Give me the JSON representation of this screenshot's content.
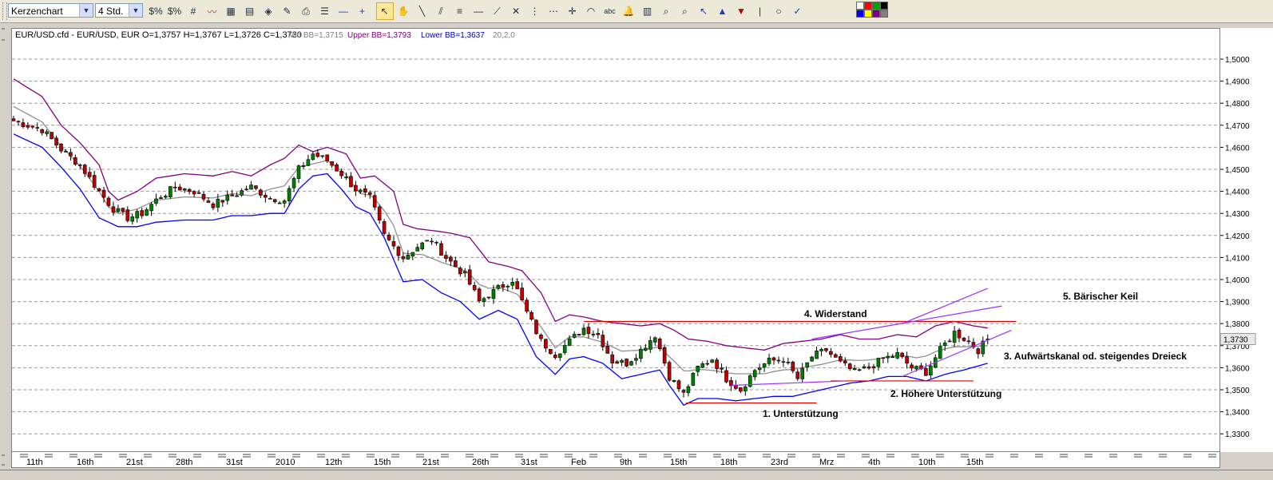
{
  "toolbar": {
    "chart_type_value": "Kerzenchart",
    "timeframe_value": "4 Std.",
    "icons": [
      "dollar-percent-icon",
      "dollar-scale-icon",
      "grid-icon",
      "line-chart-icon",
      "chart-window-icon",
      "templates-icon",
      "layers-icon",
      "drawings-icon",
      "print-icon",
      "properties-icon",
      "zoom-out-icon",
      "zoom-in-icon",
      "cursor-icon",
      "hand-icon",
      "line-tool-icon",
      "parallel-tool-icon",
      "fibonacci-icon",
      "horizontal-line-icon",
      "gann-fan-icon",
      "cross-tool-icon",
      "vertical-lines-icon",
      "dotted-lines-icon",
      "crosshair-icon",
      "arc-icon",
      "text-tool-icon",
      "bell-icon",
      "calculator-icon",
      "magnifier-icon",
      "magnifier-reset-icon",
      "arrow-up-left-icon",
      "arrow-up-icon",
      "arrow-down-icon",
      "separator-icon",
      "circle-icon",
      "checkmark-icon",
      "color-palette-icon"
    ],
    "palette": [
      "#ffffff",
      "#ff0000",
      "#00a000",
      "#000000",
      "#0000ff",
      "#ffff00",
      "#800080",
      "#808080"
    ]
  },
  "legend": {
    "symbol_text": "EUR/USD.cfd - EUR/USD, EUR O=1,3757 H=1,3767 L=1,3726 C=1,3730",
    "mid_bb": "Mid BB=1,3715",
    "upper_bb": "Upper BB=1,3793",
    "lower_bb": "Lower BB=1,3637",
    "params": "20,2,0"
  },
  "colors": {
    "upper_band": "#800080",
    "lower_band": "#0000ff",
    "mid_band": "#909090",
    "candle_up": "#008000",
    "candle_down": "#c00000",
    "annotation_red": "#e00000",
    "annotation_purple": "#9b30ff"
  },
  "chart_data": {
    "type": "candlestick",
    "symbol": "EUR/USD",
    "timeframe": "4 Std.",
    "ylim": [
      1.325,
      1.51
    ],
    "y_ticks": [
      "1,3300",
      "1,3400",
      "1,3500",
      "1,3600",
      "1,3700",
      "1,3800",
      "1,3900",
      "1,4000",
      "1,4100",
      "1,4200",
      "1,4300",
      "1,4400",
      "1,4500",
      "1,4600",
      "1,4700",
      "1,4800",
      "1,4900",
      "1,5000"
    ],
    "x_ticks": [
      "11th",
      "16th",
      "21st",
      "28th",
      "31st",
      "2010",
      "12th",
      "15th",
      "21st",
      "26th",
      "31st",
      "Feb",
      "9th",
      "15th",
      "18th",
      "23rd",
      "Mrz",
      "4th",
      "10th",
      "15th"
    ],
    "last_price": 1.373,
    "last_price_label": "1,3730",
    "grid": true,
    "close_path": [
      [
        0,
        1.472
      ],
      [
        6,
        1.468
      ],
      [
        10,
        1.459
      ],
      [
        14,
        1.452
      ],
      [
        18,
        1.44
      ],
      [
        21,
        1.432
      ],
      [
        24,
        1.428
      ],
      [
        27,
        1.43
      ],
      [
        30,
        1.436
      ],
      [
        34,
        1.442
      ],
      [
        38,
        1.44
      ],
      [
        42,
        1.434
      ],
      [
        46,
        1.438
      ],
      [
        50,
        1.442
      ],
      [
        54,
        1.437
      ],
      [
        57,
        1.436
      ],
      [
        60,
        1.45
      ],
      [
        63,
        1.457
      ],
      [
        66,
        1.454
      ],
      [
        69,
        1.448
      ],
      [
        72,
        1.441
      ],
      [
        75,
        1.437
      ],
      [
        78,
        1.42
      ],
      [
        82,
        1.41
      ],
      [
        85,
        1.415
      ],
      [
        88,
        1.418
      ],
      [
        91,
        1.41
      ],
      [
        95,
        1.402
      ],
      [
        98,
        1.39
      ],
      [
        102,
        1.396
      ],
      [
        105,
        1.4
      ],
      [
        108,
        1.385
      ],
      [
        111,
        1.372
      ],
      [
        114,
        1.366
      ],
      [
        117,
        1.372
      ],
      [
        120,
        1.378
      ],
      [
        123,
        1.375
      ],
      [
        126,
        1.363
      ],
      [
        129,
        1.362
      ],
      [
        132,
        1.368
      ],
      [
        135,
        1.375
      ],
      [
        138,
        1.356
      ],
      [
        141,
        1.348
      ],
      [
        144,
        1.36
      ],
      [
        147,
        1.364
      ],
      [
        150,
        1.355
      ],
      [
        153,
        1.35
      ],
      [
        156,
        1.359
      ],
      [
        159,
        1.363
      ],
      [
        162,
        1.364
      ],
      [
        165,
        1.355
      ],
      [
        168,
        1.365
      ],
      [
        171,
        1.368
      ],
      [
        174,
        1.362
      ],
      [
        177,
        1.358
      ],
      [
        180,
        1.36
      ],
      [
        183,
        1.364
      ],
      [
        186,
        1.366
      ],
      [
        189,
        1.36
      ],
      [
        192,
        1.358
      ],
      [
        195,
        1.368
      ],
      [
        198,
        1.376
      ],
      [
        201,
        1.372
      ],
      [
        203,
        1.368
      ],
      [
        205,
        1.373
      ]
    ],
    "upper_band": [
      [
        0,
        1.491
      ],
      [
        6,
        1.483
      ],
      [
        10,
        1.47
      ],
      [
        14,
        1.462
      ],
      [
        18,
        1.452
      ],
      [
        20,
        1.44
      ],
      [
        22,
        1.436
      ],
      [
        26,
        1.44
      ],
      [
        30,
        1.446
      ],
      [
        36,
        1.448
      ],
      [
        42,
        1.447
      ],
      [
        46,
        1.449
      ],
      [
        50,
        1.447
      ],
      [
        54,
        1.452
      ],
      [
        57,
        1.455
      ],
      [
        60,
        1.461
      ],
      [
        63,
        1.458
      ],
      [
        66,
        1.46
      ],
      [
        70,
        1.457
      ],
      [
        73,
        1.446
      ],
      [
        76,
        1.447
      ],
      [
        80,
        1.44
      ],
      [
        82,
        1.425
      ],
      [
        85,
        1.423
      ],
      [
        89,
        1.422
      ],
      [
        92,
        1.421
      ],
      [
        96,
        1.419
      ],
      [
        100,
        1.408
      ],
      [
        104,
        1.406
      ],
      [
        107,
        1.404
      ],
      [
        111,
        1.394
      ],
      [
        114,
        1.381
      ],
      [
        117,
        1.384
      ],
      [
        120,
        1.383
      ],
      [
        124,
        1.381
      ],
      [
        128,
        1.38
      ],
      [
        132,
        1.379
      ],
      [
        136,
        1.38
      ],
      [
        139,
        1.377
      ],
      [
        142,
        1.373
      ],
      [
        146,
        1.372
      ],
      [
        150,
        1.37
      ],
      [
        154,
        1.369
      ],
      [
        158,
        1.368
      ],
      [
        162,
        1.371
      ],
      [
        166,
        1.372
      ],
      [
        170,
        1.373
      ],
      [
        174,
        1.375
      ],
      [
        178,
        1.373
      ],
      [
        182,
        1.373
      ],
      [
        186,
        1.375
      ],
      [
        190,
        1.374
      ],
      [
        194,
        1.379
      ],
      [
        198,
        1.381
      ],
      [
        202,
        1.379
      ],
      [
        205,
        1.378
      ]
    ],
    "lower_band": [
      [
        0,
        1.466
      ],
      [
        6,
        1.46
      ],
      [
        10,
        1.451
      ],
      [
        14,
        1.441
      ],
      [
        18,
        1.428
      ],
      [
        22,
        1.424
      ],
      [
        26,
        1.424
      ],
      [
        30,
        1.426
      ],
      [
        36,
        1.427
      ],
      [
        42,
        1.427
      ],
      [
        46,
        1.429
      ],
      [
        50,
        1.429
      ],
      [
        54,
        1.43
      ],
      [
        57,
        1.43
      ],
      [
        60,
        1.441
      ],
      [
        63,
        1.447
      ],
      [
        66,
        1.448
      ],
      [
        69,
        1.441
      ],
      [
        72,
        1.433
      ],
      [
        75,
        1.43
      ],
      [
        78,
        1.419
      ],
      [
        82,
        1.399
      ],
      [
        86,
        1.4
      ],
      [
        90,
        1.394
      ],
      [
        94,
        1.39
      ],
      [
        98,
        1.382
      ],
      [
        102,
        1.386
      ],
      [
        106,
        1.382
      ],
      [
        110,
        1.365
      ],
      [
        114,
        1.357
      ],
      [
        117,
        1.364
      ],
      [
        120,
        1.365
      ],
      [
        124,
        1.362
      ],
      [
        128,
        1.355
      ],
      [
        132,
        1.357
      ],
      [
        136,
        1.359
      ],
      [
        138,
        1.352
      ],
      [
        141,
        1.343
      ],
      [
        144,
        1.346
      ],
      [
        148,
        1.346
      ],
      [
        152,
        1.345
      ],
      [
        156,
        1.346
      ],
      [
        160,
        1.347
      ],
      [
        164,
        1.347
      ],
      [
        168,
        1.349
      ],
      [
        172,
        1.351
      ],
      [
        176,
        1.353
      ],
      [
        180,
        1.354
      ],
      [
        184,
        1.356
      ],
      [
        188,
        1.356
      ],
      [
        192,
        1.354
      ],
      [
        196,
        1.357
      ],
      [
        200,
        1.359
      ],
      [
        205,
        1.362
      ]
    ],
    "annotations": [
      {
        "label": "1. Unterstützung",
        "line": [
          [
            141.5,
            1.344
          ],
          [
            169,
            1.344
          ]
        ],
        "color": "red"
      },
      {
        "label": "2. Höhere Unterstützung",
        "line": [
          [
            172,
            1.354
          ],
          [
            202,
            1.354
          ]
        ],
        "color": "red"
      },
      {
        "label": "3. Aufwärtskanal od. steigendes Dreieck",
        "line": [
          [
            187,
            1.356
          ],
          [
            210,
            1.377
          ]
        ],
        "color": "purple"
      },
      {
        "label": "4. Widerstand",
        "line": [
          [
            120,
            1.381
          ],
          [
            211,
            1.381
          ]
        ],
        "color": "red"
      },
      {
        "label": "5. Bärischer Keil",
        "lines": [
          [
            [
              168,
              1.373
            ],
            [
              208,
              1.388
            ]
          ],
          [
            [
              187,
              1.38
            ],
            [
              205,
              1.396
            ]
          ]
        ],
        "color": "purple"
      }
    ]
  }
}
